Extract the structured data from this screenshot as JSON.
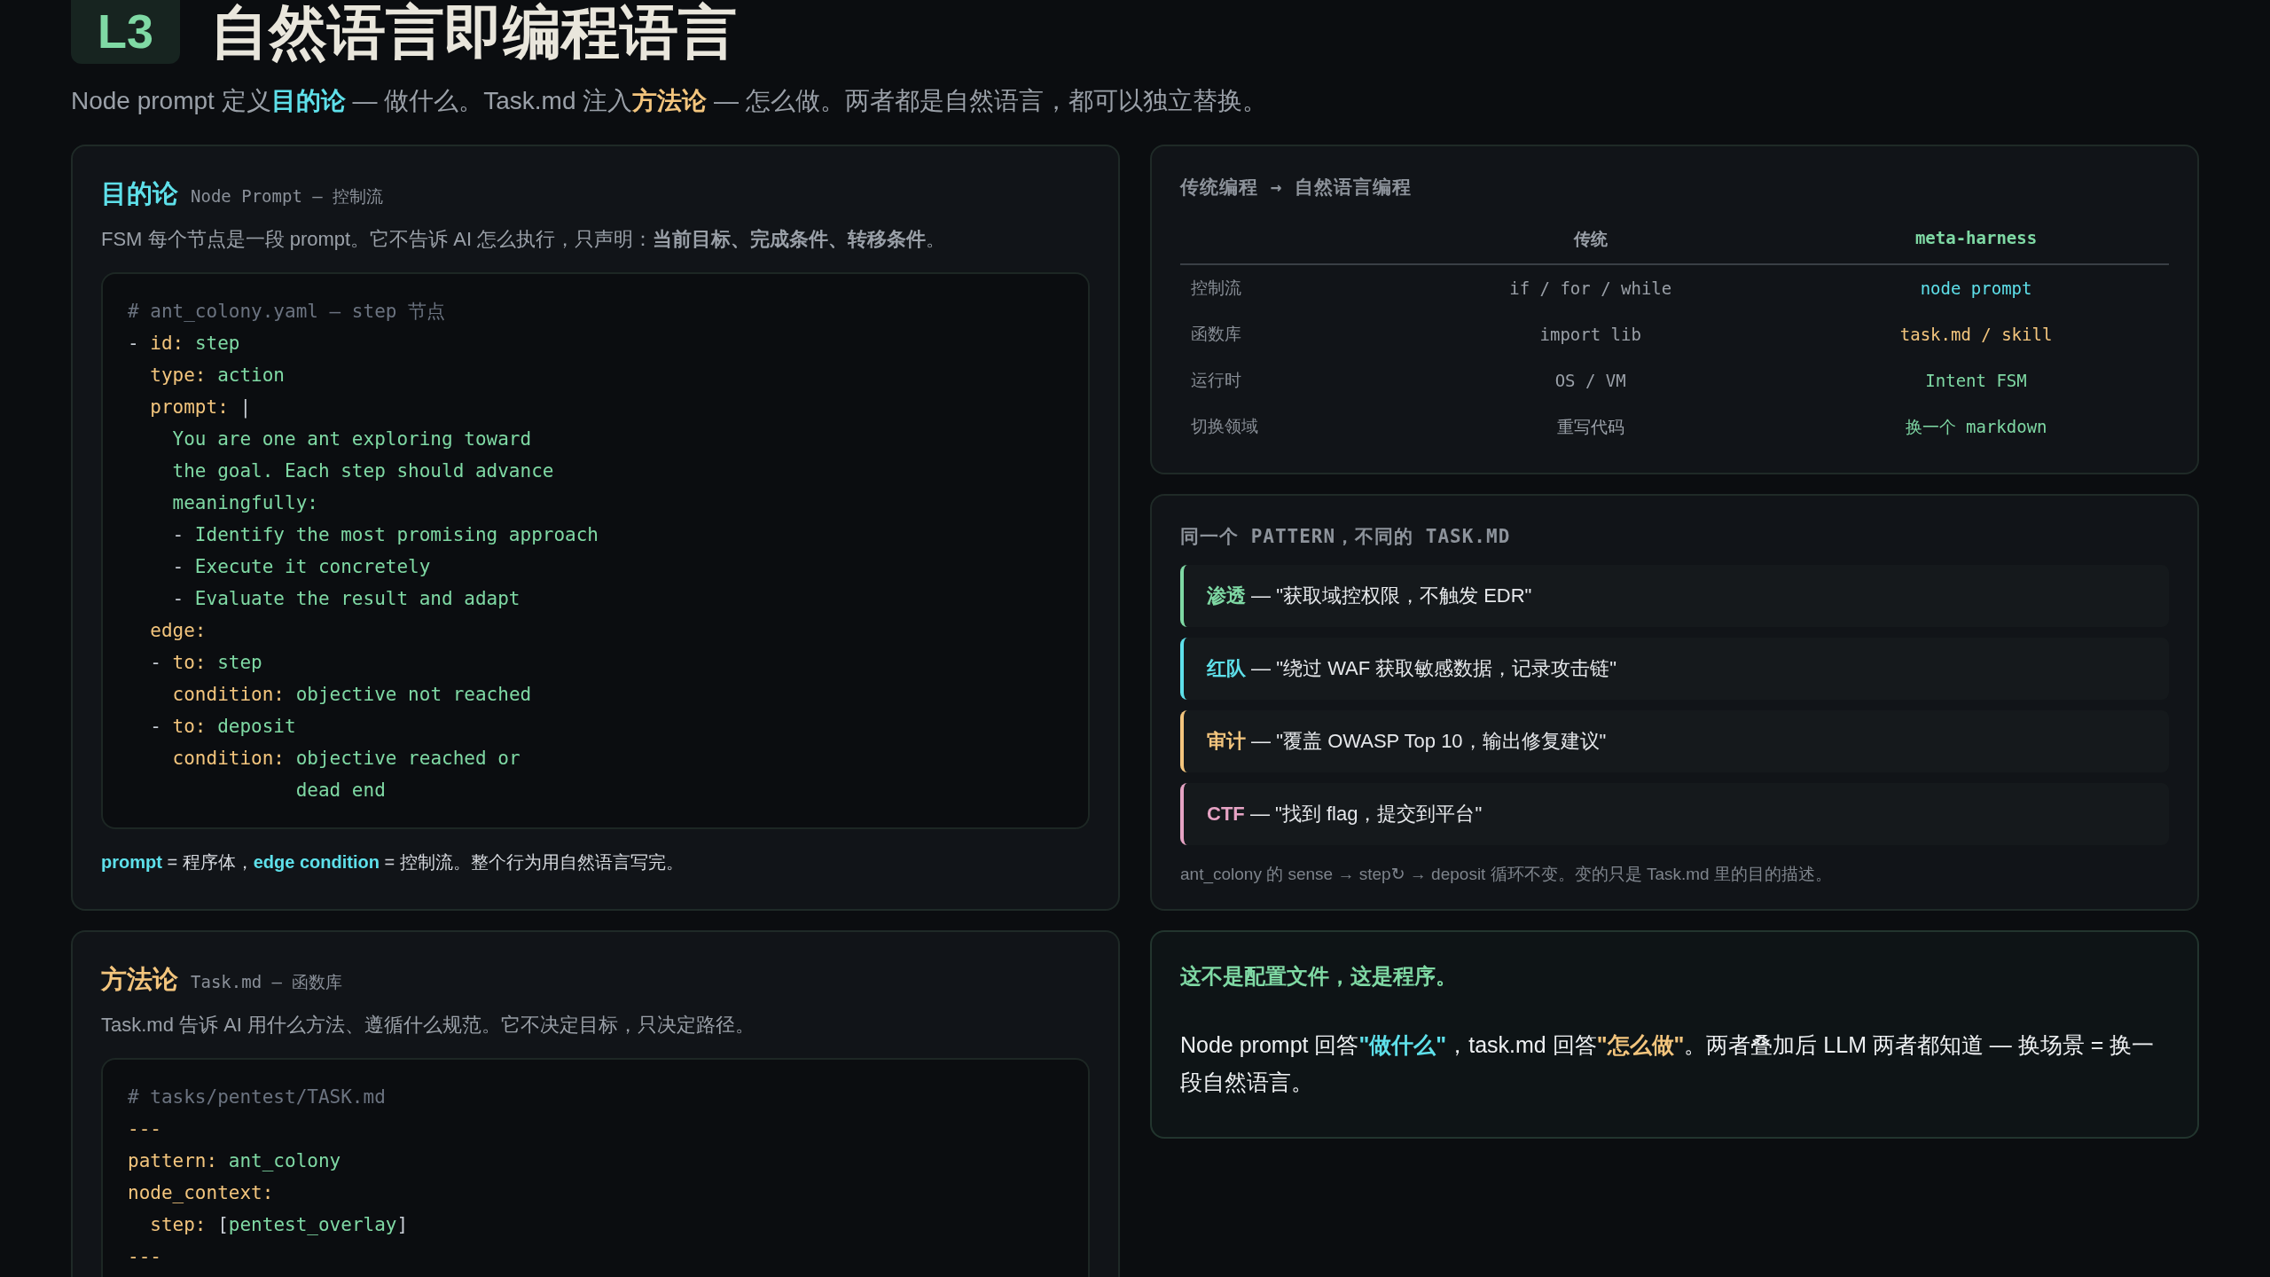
{
  "header": {
    "badge": "L3",
    "title": "自然语言即编程语言"
  },
  "subtitle": [
    {
      "kind": "plain",
      "text": "Node prompt 定义"
    },
    {
      "kind": "teal",
      "text": "目的论"
    },
    {
      "kind": "plain",
      "text": " — 做什么。Task.md 注入"
    },
    {
      "kind": "amber",
      "text": "方法论"
    },
    {
      "kind": "plain",
      "text": " — 怎么做。两者都是自然语言，都可以独立替换。"
    }
  ],
  "goal_card": {
    "title": "目的论",
    "subtitle": "Node Prompt — 控制流",
    "description": "FSM 每个节点是一段 prompt。它不告诉 AI 怎么执行，只声明：**当前目标、完成条件、转移条件**。",
    "code": [
      [
        {
          "kind": "comment",
          "text": "# ant_colony.yaml — step 节点"
        }
      ],
      [
        {
          "kind": "plain",
          "text": "- "
        },
        {
          "kind": "key",
          "text": "id:"
        },
        {
          "kind": "value",
          "text": " step"
        }
      ],
      [
        {
          "kind": "key",
          "text": "  type:"
        },
        {
          "kind": "value",
          "text": " action"
        }
      ],
      [
        {
          "kind": "key",
          "text": "  prompt:"
        },
        {
          "kind": "plain",
          "text": " |"
        }
      ],
      [
        {
          "kind": "value",
          "text": "    You are one ant exploring toward"
        }
      ],
      [
        {
          "kind": "value",
          "text": "    the goal. Each step should advance"
        }
      ],
      [
        {
          "kind": "value",
          "text": "    meaningfully:"
        }
      ],
      [
        {
          "kind": "plain",
          "text": "    - "
        },
        {
          "kind": "value",
          "text": "Identify the most promising approach"
        }
      ],
      [
        {
          "kind": "plain",
          "text": "    - "
        },
        {
          "kind": "value",
          "text": "Execute it concretely"
        }
      ],
      [
        {
          "kind": "plain",
          "text": "    - "
        },
        {
          "kind": "value",
          "text": "Evaluate the result and adapt"
        }
      ],
      [
        {
          "kind": "key",
          "text": "  edge:"
        }
      ],
      [
        {
          "kind": "plain",
          "text": "  - "
        },
        {
          "kind": "key",
          "text": "to:"
        },
        {
          "kind": "value",
          "text": " step"
        }
      ],
      [
        {
          "kind": "key",
          "text": "    condition:"
        },
        {
          "kind": "value",
          "text": " objective not reached"
        }
      ],
      [
        {
          "kind": "plain",
          "text": "  - "
        },
        {
          "kind": "key",
          "text": "to:"
        },
        {
          "kind": "value",
          "text": " deposit"
        }
      ],
      [
        {
          "kind": "key",
          "text": "    condition:"
        },
        {
          "kind": "value",
          "text": " objective reached or"
        }
      ],
      [
        {
          "kind": "value",
          "text": "               dead end"
        }
      ]
    ],
    "footer": [
      {
        "kind": "teal",
        "text": "prompt"
      },
      {
        "kind": "plain",
        "text": " = 程序体，"
      },
      {
        "kind": "teal",
        "text": "edge condition"
      },
      {
        "kind": "plain",
        "text": " = 控制流。整个行为用自然语言写完。"
      }
    ]
  },
  "comparison": {
    "title": "传统编程 → 自然语言编程",
    "columns": [
      "传统",
      "meta-harness"
    ],
    "rows": [
      {
        "label": "控制流",
        "traditional": "if / for / while",
        "meta": "node prompt",
        "color": "#5ee0ea"
      },
      {
        "label": "函数库",
        "traditional": "import lib",
        "meta": "task.md / skill",
        "color": "#f3c57d"
      },
      {
        "label": "运行时",
        "traditional": "OS / VM",
        "meta": "Intent FSM",
        "color": "#7fd9a4"
      },
      {
        "label": "切换领域",
        "traditional": "重写代码",
        "meta": "换一个 markdown",
        "color": "#7fd9a4"
      }
    ]
  },
  "patterns": {
    "title": "同一个 PATTERN，不同的 TASK.MD",
    "items": [
      {
        "name": "渗透",
        "quote": " — \"获取域控权限，不触发 EDR\"",
        "color": "#7fd9a4"
      },
      {
        "name": "红队",
        "quote": " — \"绕过 WAF 获取敏感数据，记录攻击链\"",
        "color": "#5ee0ea"
      },
      {
        "name": "审计",
        "quote": " — \"覆盖 OWASP Top 10，输出修复建议\"",
        "color": "#f3c57d"
      },
      {
        "name": "CTF",
        "quote": " — \"找到 flag，提交到平台\"",
        "color": "#e6a3c4"
      }
    ],
    "note": "ant_colony 的 sense → step↻ → deposit 循环不变。变的只是 Task.md 里的目的描述。"
  },
  "method_card": {
    "title": "方法论",
    "subtitle": "Task.md — 函数库",
    "description": "Task.md 告诉 AI 用什么方法、遵循什么规范。它不决定目标，只决定路径。",
    "code": [
      [
        {
          "kind": "comment",
          "text": "# tasks/pentest/TASK.md"
        }
      ],
      [
        {
          "kind": "key",
          "text": "---"
        }
      ],
      [
        {
          "kind": "key",
          "text": "pattern:"
        },
        {
          "kind": "value",
          "text": " ant_colony"
        }
      ],
      [
        {
          "kind": "key",
          "text": "node_context:"
        }
      ],
      [
        {
          "kind": "key",
          "text": "  step:"
        },
        {
          "kind": "plain",
          "text": " ["
        },
        {
          "kind": "value",
          "text": "pentest_overlay"
        },
        {
          "kind": "plain",
          "text": "]"
        }
      ],
      [
        {
          "kind": "key",
          "text": "---"
        }
      ]
    ]
  },
  "conclusion": {
    "title": "这不是配置文件，这是程序。",
    "body": [
      {
        "kind": "plain",
        "text": "Node prompt 回答"
      },
      {
        "kind": "teal",
        "text": "\"做什么\""
      },
      {
        "kind": "plain",
        "text": "，task.md 回答"
      },
      {
        "kind": "amber",
        "text": "\"怎么做\""
      },
      {
        "kind": "plain",
        "text": "。两者叠加后 LLM 两者都知道 — 换场景 = 换一段自然语言。"
      }
    ]
  }
}
